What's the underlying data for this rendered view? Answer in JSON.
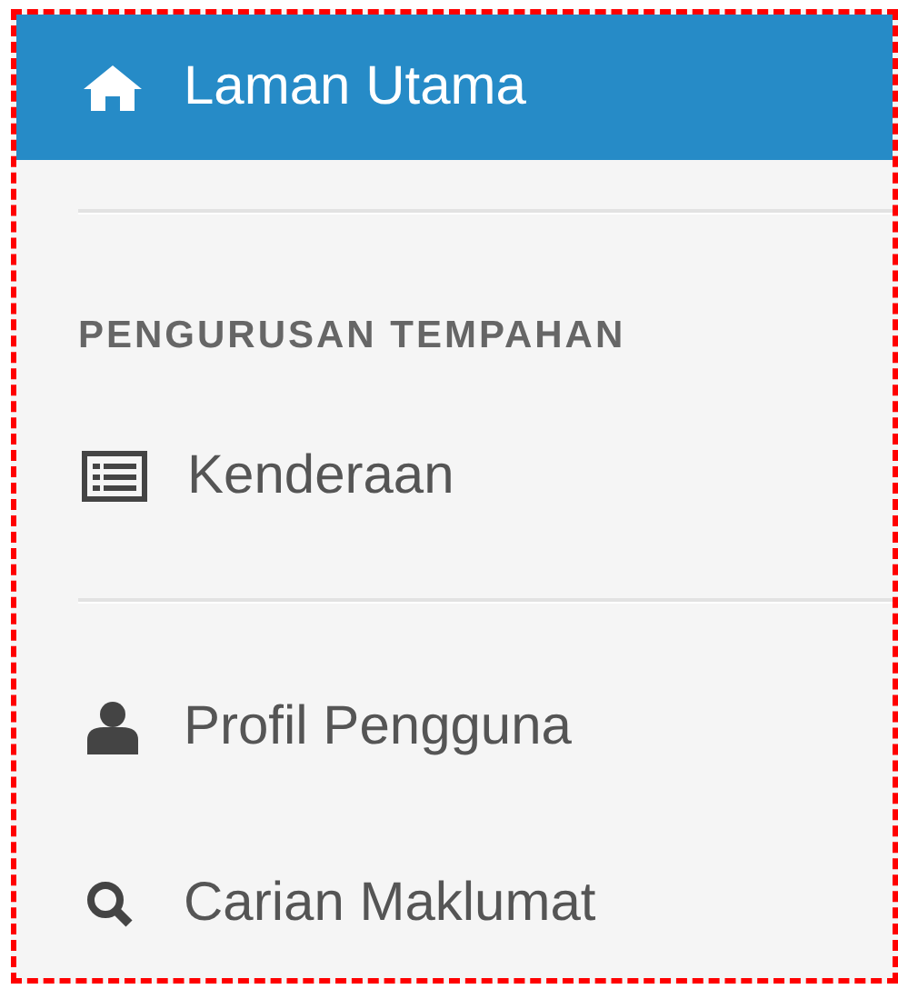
{
  "sidebar": {
    "items": [
      {
        "kind": "link",
        "label": "Laman Utama",
        "selected": true
      },
      {
        "kind": "divider"
      },
      {
        "kind": "heading",
        "label": "PENGURUSAN TEMPAHAN"
      },
      {
        "kind": "link",
        "label": "Kenderaan",
        "selected": false
      },
      {
        "kind": "divider"
      },
      {
        "kind": "link",
        "label": "Profil Pengguna",
        "selected": false
      },
      {
        "kind": "link",
        "label": "Carian Maklumat",
        "selected": false
      }
    ]
  }
}
